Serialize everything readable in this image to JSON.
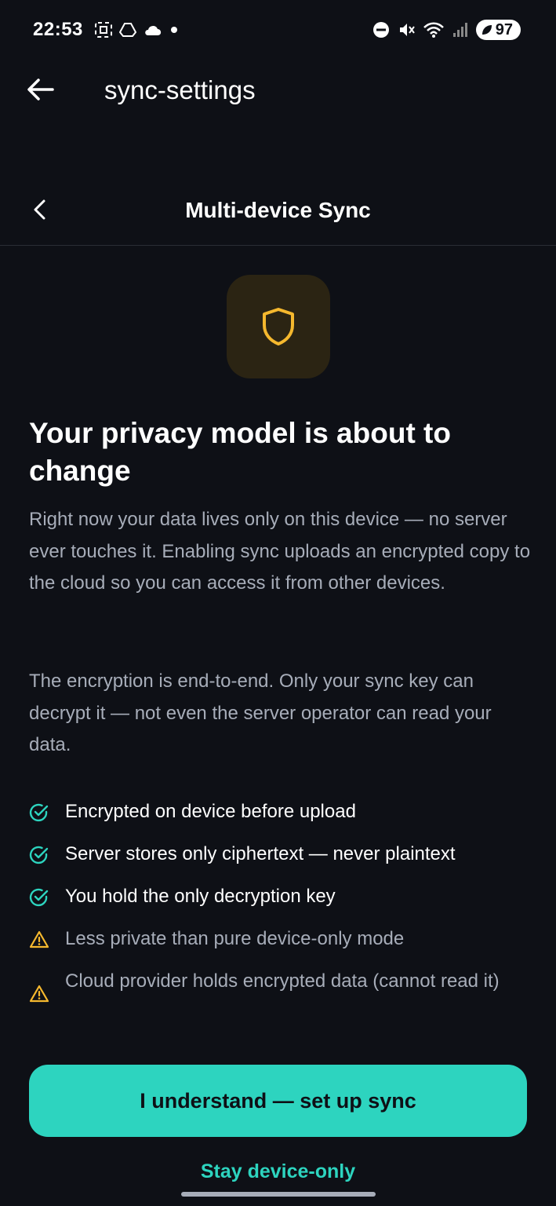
{
  "status_bar": {
    "time": "22:53",
    "battery": "97",
    "icons": [
      "screenshot-icon",
      "drive-icon",
      "cloud-icon",
      "dot-icon",
      "dnd-icon",
      "mute-icon",
      "wifi-icon",
      "signal-icon",
      "battery-icon"
    ]
  },
  "app_bar": {
    "title": "sync-settings"
  },
  "sub_header": {
    "title": "Multi-device Sync"
  },
  "content": {
    "heading": "Your privacy model is about to change",
    "paragraph1": "Right now your data lives only on this device — no server ever touches it. Enabling sync uploads an encrypted copy to the cloud so you can access it from other devices.",
    "paragraph2": "The encryption is end-to-end. Only your sync key can decrypt it — not even the server operator can read your data.",
    "features": [
      {
        "icon": "check-circle-icon",
        "text": "Encrypted on device before upload"
      },
      {
        "icon": "check-circle-icon",
        "text": "Server stores only ciphertext — never plaintext"
      },
      {
        "icon": "check-circle-icon",
        "text": "You hold the only decryption key"
      },
      {
        "icon": "warning-icon",
        "text": "Less private than pure device-only mode"
      },
      {
        "icon": "warning-icon",
        "text": "Cloud provider holds encrypted data (cannot read it)"
      }
    ]
  },
  "actions": {
    "primary": "I understand — set up sync",
    "secondary": "Stay device-only"
  },
  "colors": {
    "background": "#0e1016",
    "accent": "#2dd4bf",
    "warning": "#f5b82e",
    "muted_text": "#a7adb9"
  }
}
